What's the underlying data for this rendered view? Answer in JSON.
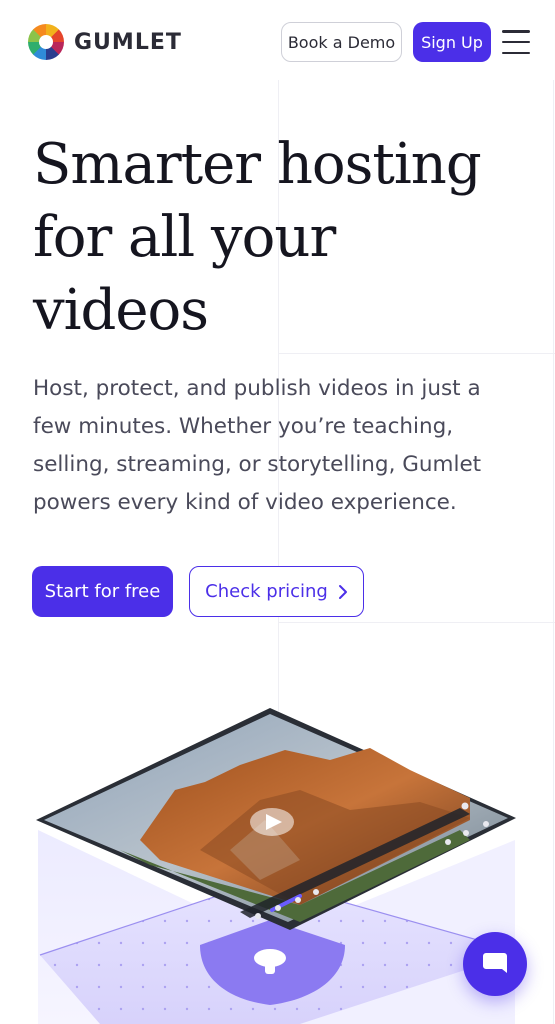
{
  "header": {
    "logo_text": "GUMLET",
    "book_demo_label": "Book a Demo",
    "sign_up_label": "Sign Up"
  },
  "hero": {
    "title_line1": "Smarter hosting",
    "title_line2": "for all your",
    "title_line3": "videos",
    "subtitle": "Host, protect, and publish videos in just a few minutes. Whether you’re teaching, selling, streaming, or storytelling, Gumlet powers every kind of video experience.",
    "start_label": "Start for free",
    "pricing_label": "Check pricing"
  },
  "colors": {
    "brand": "#4b2fe8",
    "text_dark": "#15151f",
    "text_muted": "#4a4a5a"
  },
  "icons": {
    "menu": "hamburger-icon",
    "pricing_arrow": "chevron-right-icon",
    "chat": "chat-icon",
    "play": "play-icon"
  }
}
